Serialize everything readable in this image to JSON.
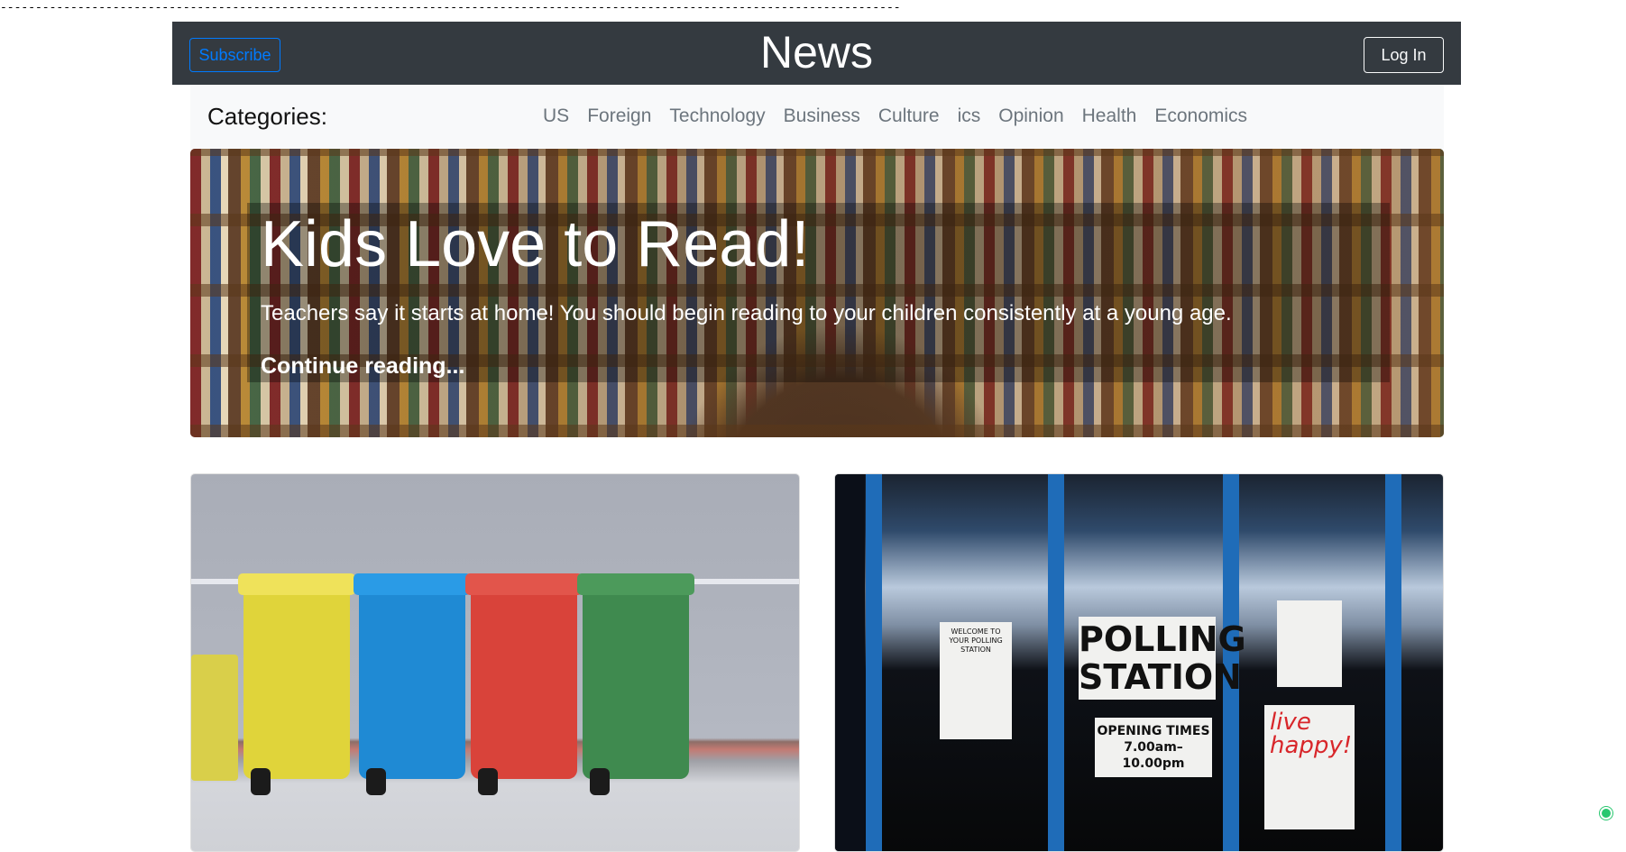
{
  "divider_text": "------------------------------------------------------------------------------------------------------------------------------------------------------",
  "header": {
    "subscribe_label": "Subscribe",
    "brand": "News",
    "login_label": "Log In"
  },
  "categories": {
    "label": "Categories:",
    "items": [
      "US",
      "Foreign",
      "Technology",
      "Business",
      "Culture",
      "ics",
      "Opinion",
      "Health",
      "Economics"
    ]
  },
  "hero": {
    "title": "Kids Love to Read!",
    "subtitle": "Teachers say it starts at home! You should begin reading to your children consistently at a young age.",
    "link": "Continue reading..."
  },
  "cards": {
    "right_signs": {
      "polling": "POLLING STATION",
      "opening": "OPENING TIMES 7.00am–10.00pm",
      "welcome": "WELCOME TO YOUR POLLING STATION",
      "live": "live happy!"
    }
  },
  "colors": {
    "topbar": "#343a40",
    "subscribe": "#007bff",
    "catbar": "#f8f9fa",
    "category_link": "#6c757d"
  }
}
